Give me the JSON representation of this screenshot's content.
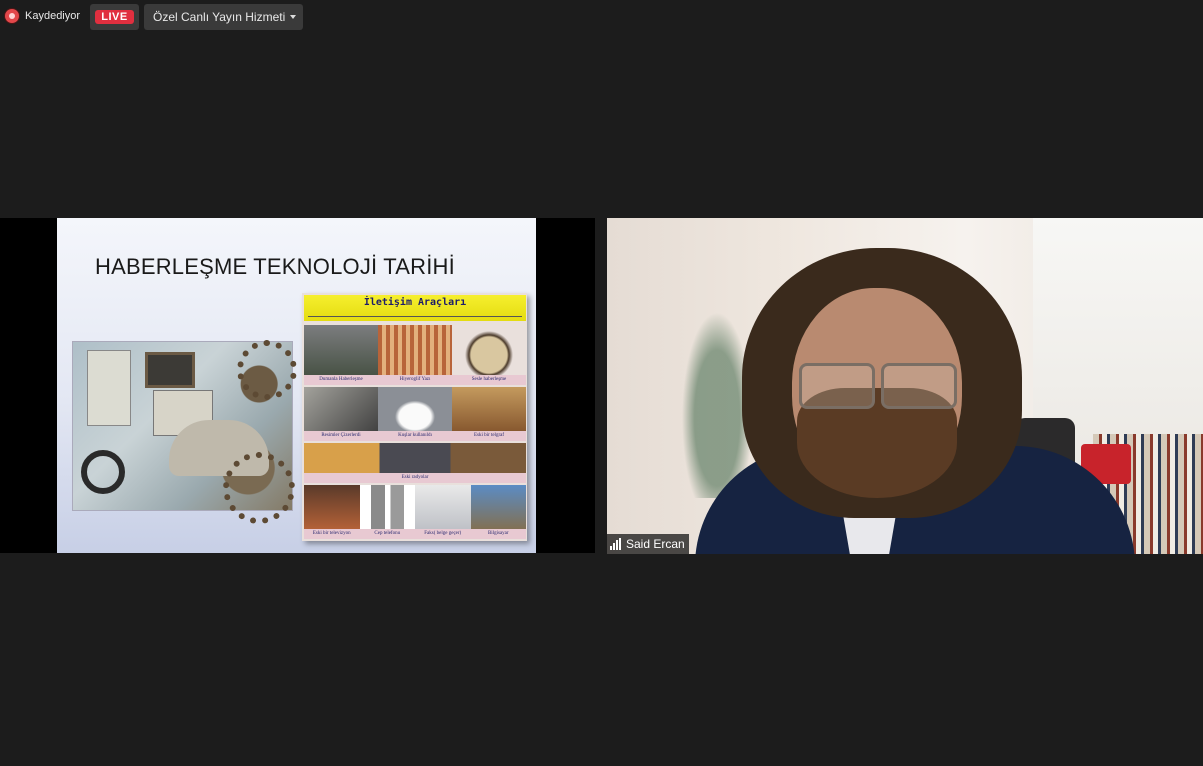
{
  "topbar": {
    "recording_label": "Kaydediyor",
    "live_label": "LIVE",
    "stream_service_label": "Özel Canlı Yayın Hizmeti"
  },
  "share": {
    "slide_title": "HABERLEŞME TEKNOLOJİ TARİHİ",
    "panel_title": "İletişim Araçları",
    "rows": [
      [
        "Dumanla Haberleşme",
        "Hiyeroglif Yazı",
        "Sesle haberleşme"
      ],
      [
        "Resimler Çizerlerdi",
        "Kuşlar  kullanıldı",
        "Eski bir telgraf"
      ],
      [
        "Eski radyolar"
      ],
      [
        "Eski bir televizyon",
        "Cep telefonu",
        "Faks( belge geçer)",
        "Bilgisayar"
      ]
    ]
  },
  "camera": {
    "participant_name": "Said Ercan"
  },
  "colors": {
    "live_red": "#e02f3f",
    "panel_yellow": "#f6ef2e",
    "background": "#1c1c1c"
  }
}
